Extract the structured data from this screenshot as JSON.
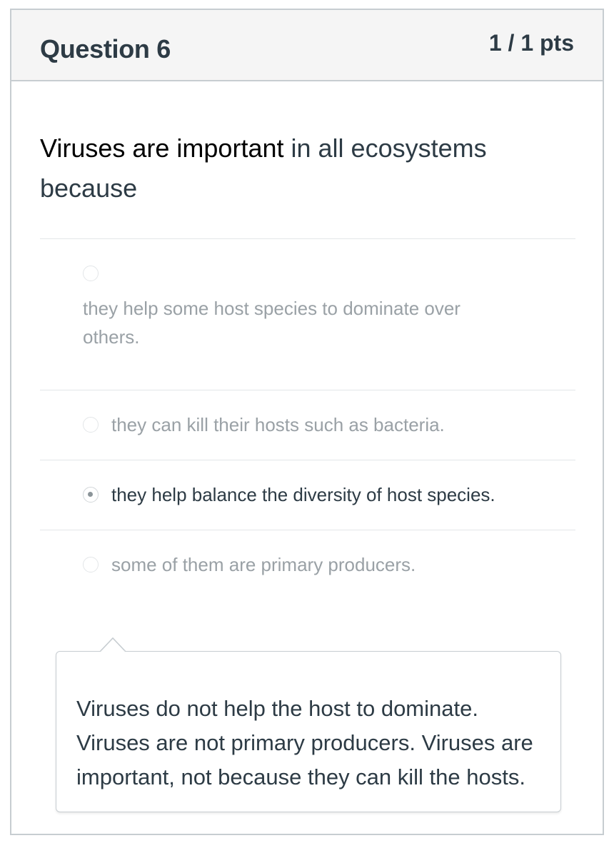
{
  "question": {
    "title": "Question 6",
    "points": "1 / 1 pts",
    "text_part1": "Viruses are important",
    "text_part2": " in all ecosystems because"
  },
  "answers": [
    {
      "label": "they help some host species to dominate over others.",
      "selected": false
    },
    {
      "label": "they can kill their hosts such as bacteria.",
      "selected": false
    },
    {
      "label": "they help balance the diversity of host species.",
      "selected": true
    },
    {
      "label": "some of them are primary producers.",
      "selected": false
    }
  ],
  "feedback": {
    "text": "Viruses do not help the host to dominate. Viruses are not primary producers. Viruses are important, not because they can kill the hosts."
  },
  "colors": {
    "text": "#2d3b45",
    "muted": "#9aa1a6",
    "border": "#c7cdd1",
    "header_bg": "#f5f5f5"
  }
}
